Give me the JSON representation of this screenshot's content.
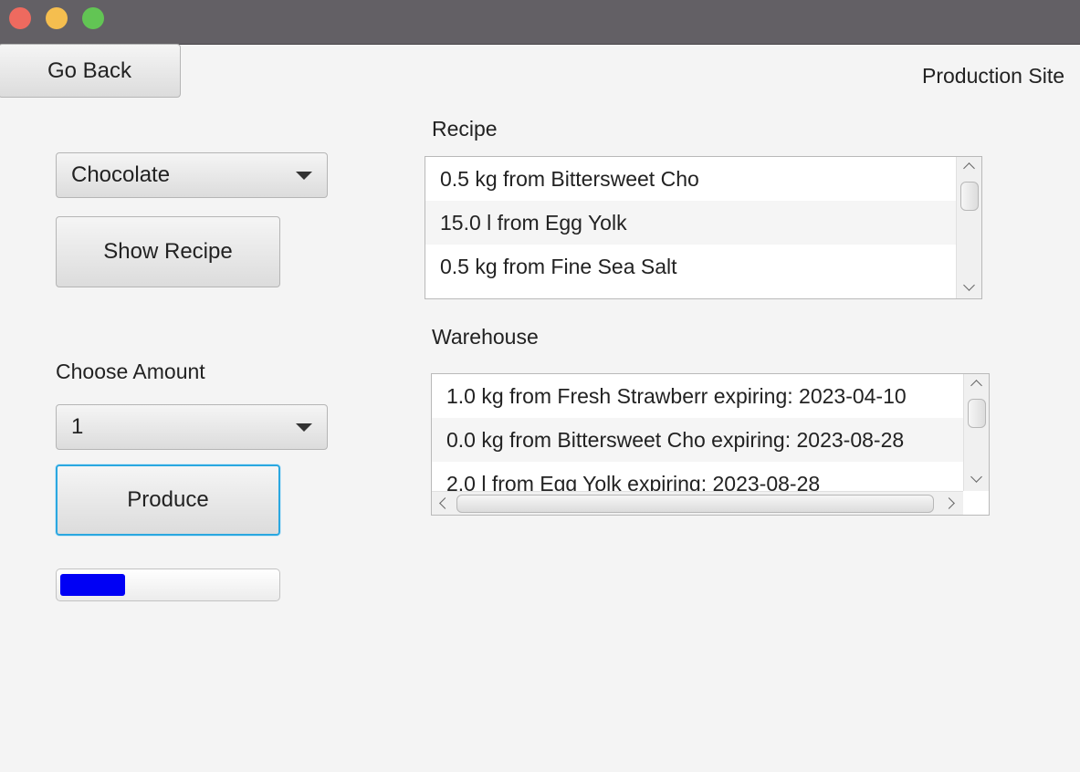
{
  "header": {
    "back_label": "Go Back",
    "site_title": "Production Site"
  },
  "product_select": {
    "value": "Chocolate"
  },
  "show_recipe_label": "Show Recipe",
  "amount": {
    "label": "Choose Amount",
    "value": "1"
  },
  "produce_label": "Produce",
  "progress": {
    "value": 0.3,
    "color": "#0000f5"
  },
  "recipe": {
    "title": "Recipe",
    "items": [
      "0.5 kg from Bittersweet Cho",
      "15.0 l from Egg Yolk",
      "0.5 kg from Fine Sea Salt"
    ]
  },
  "warehouse": {
    "title": "Warehouse",
    "items": [
      "1.0 kg from Fresh Strawberr expiring: 2023-04-10",
      "0.0 kg from Bittersweet Cho expiring: 2023-08-28",
      "2.0 l from Egg Yolk expiring: 2023-08-28"
    ]
  },
  "colors": {
    "focus": "#2aa7e0",
    "window_bg": "#f4f4f4",
    "titlebar": "#636065"
  }
}
